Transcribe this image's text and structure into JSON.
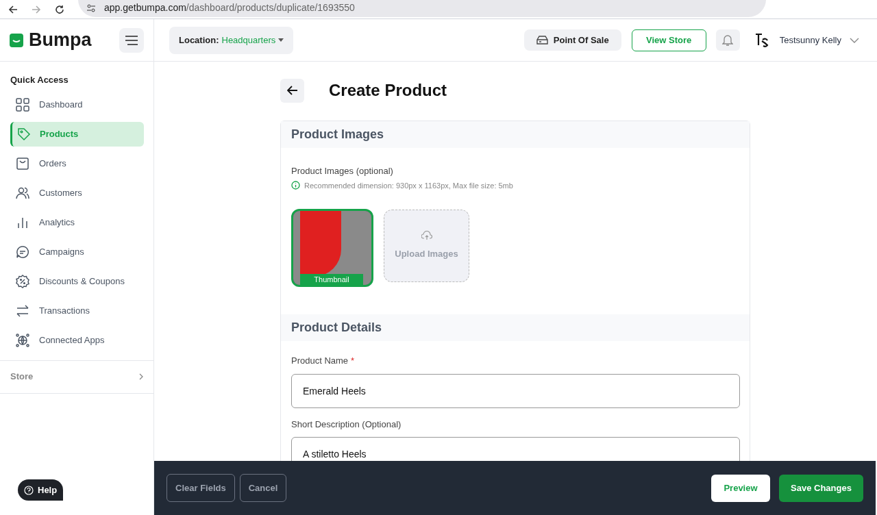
{
  "browser": {
    "url_host": "app.getbumpa.com",
    "url_path": "/dashboard/products/duplicate/1693550"
  },
  "header": {
    "logo": "Bumpa",
    "location_label": "Location:",
    "location_value": "Headquarters",
    "pos_button": "Point Of Sale",
    "view_store_button": "View Store",
    "user_name": "Testsunny Kelly"
  },
  "sidebar": {
    "section": "Quick Access",
    "items": [
      {
        "label": "Dashboard",
        "selected": false
      },
      {
        "label": "Products",
        "selected": true
      },
      {
        "label": "Orders",
        "selected": false
      },
      {
        "label": "Customers",
        "selected": false
      },
      {
        "label": "Analytics",
        "selected": false
      },
      {
        "label": "Campaigns",
        "selected": false
      },
      {
        "label": "Discounts & Coupons",
        "selected": false
      },
      {
        "label": "Transactions",
        "selected": false
      },
      {
        "label": "Connected Apps",
        "selected": false
      }
    ],
    "store": "Store",
    "help": "Help"
  },
  "page": {
    "title": "Create Product",
    "images_section": {
      "heading": "Product Images",
      "label": "Product Images (optional)",
      "hint": "Recommended dimension: 930px x 1163px, Max file size: 5mb",
      "thumbnail_label": "Thumbnail",
      "upload_label": "Upload Images"
    },
    "details_section": {
      "heading": "Product Details",
      "fields": [
        {
          "label": "Product Name",
          "required_mark": "*",
          "value": "Emerald Heels"
        },
        {
          "label": "Short Description (Optional)",
          "value": "A stiletto Heels"
        }
      ]
    }
  },
  "footer": {
    "left_buttons": [
      "Clear Fields",
      "Cancel"
    ],
    "preview": "Preview",
    "save": "Save Changes"
  }
}
